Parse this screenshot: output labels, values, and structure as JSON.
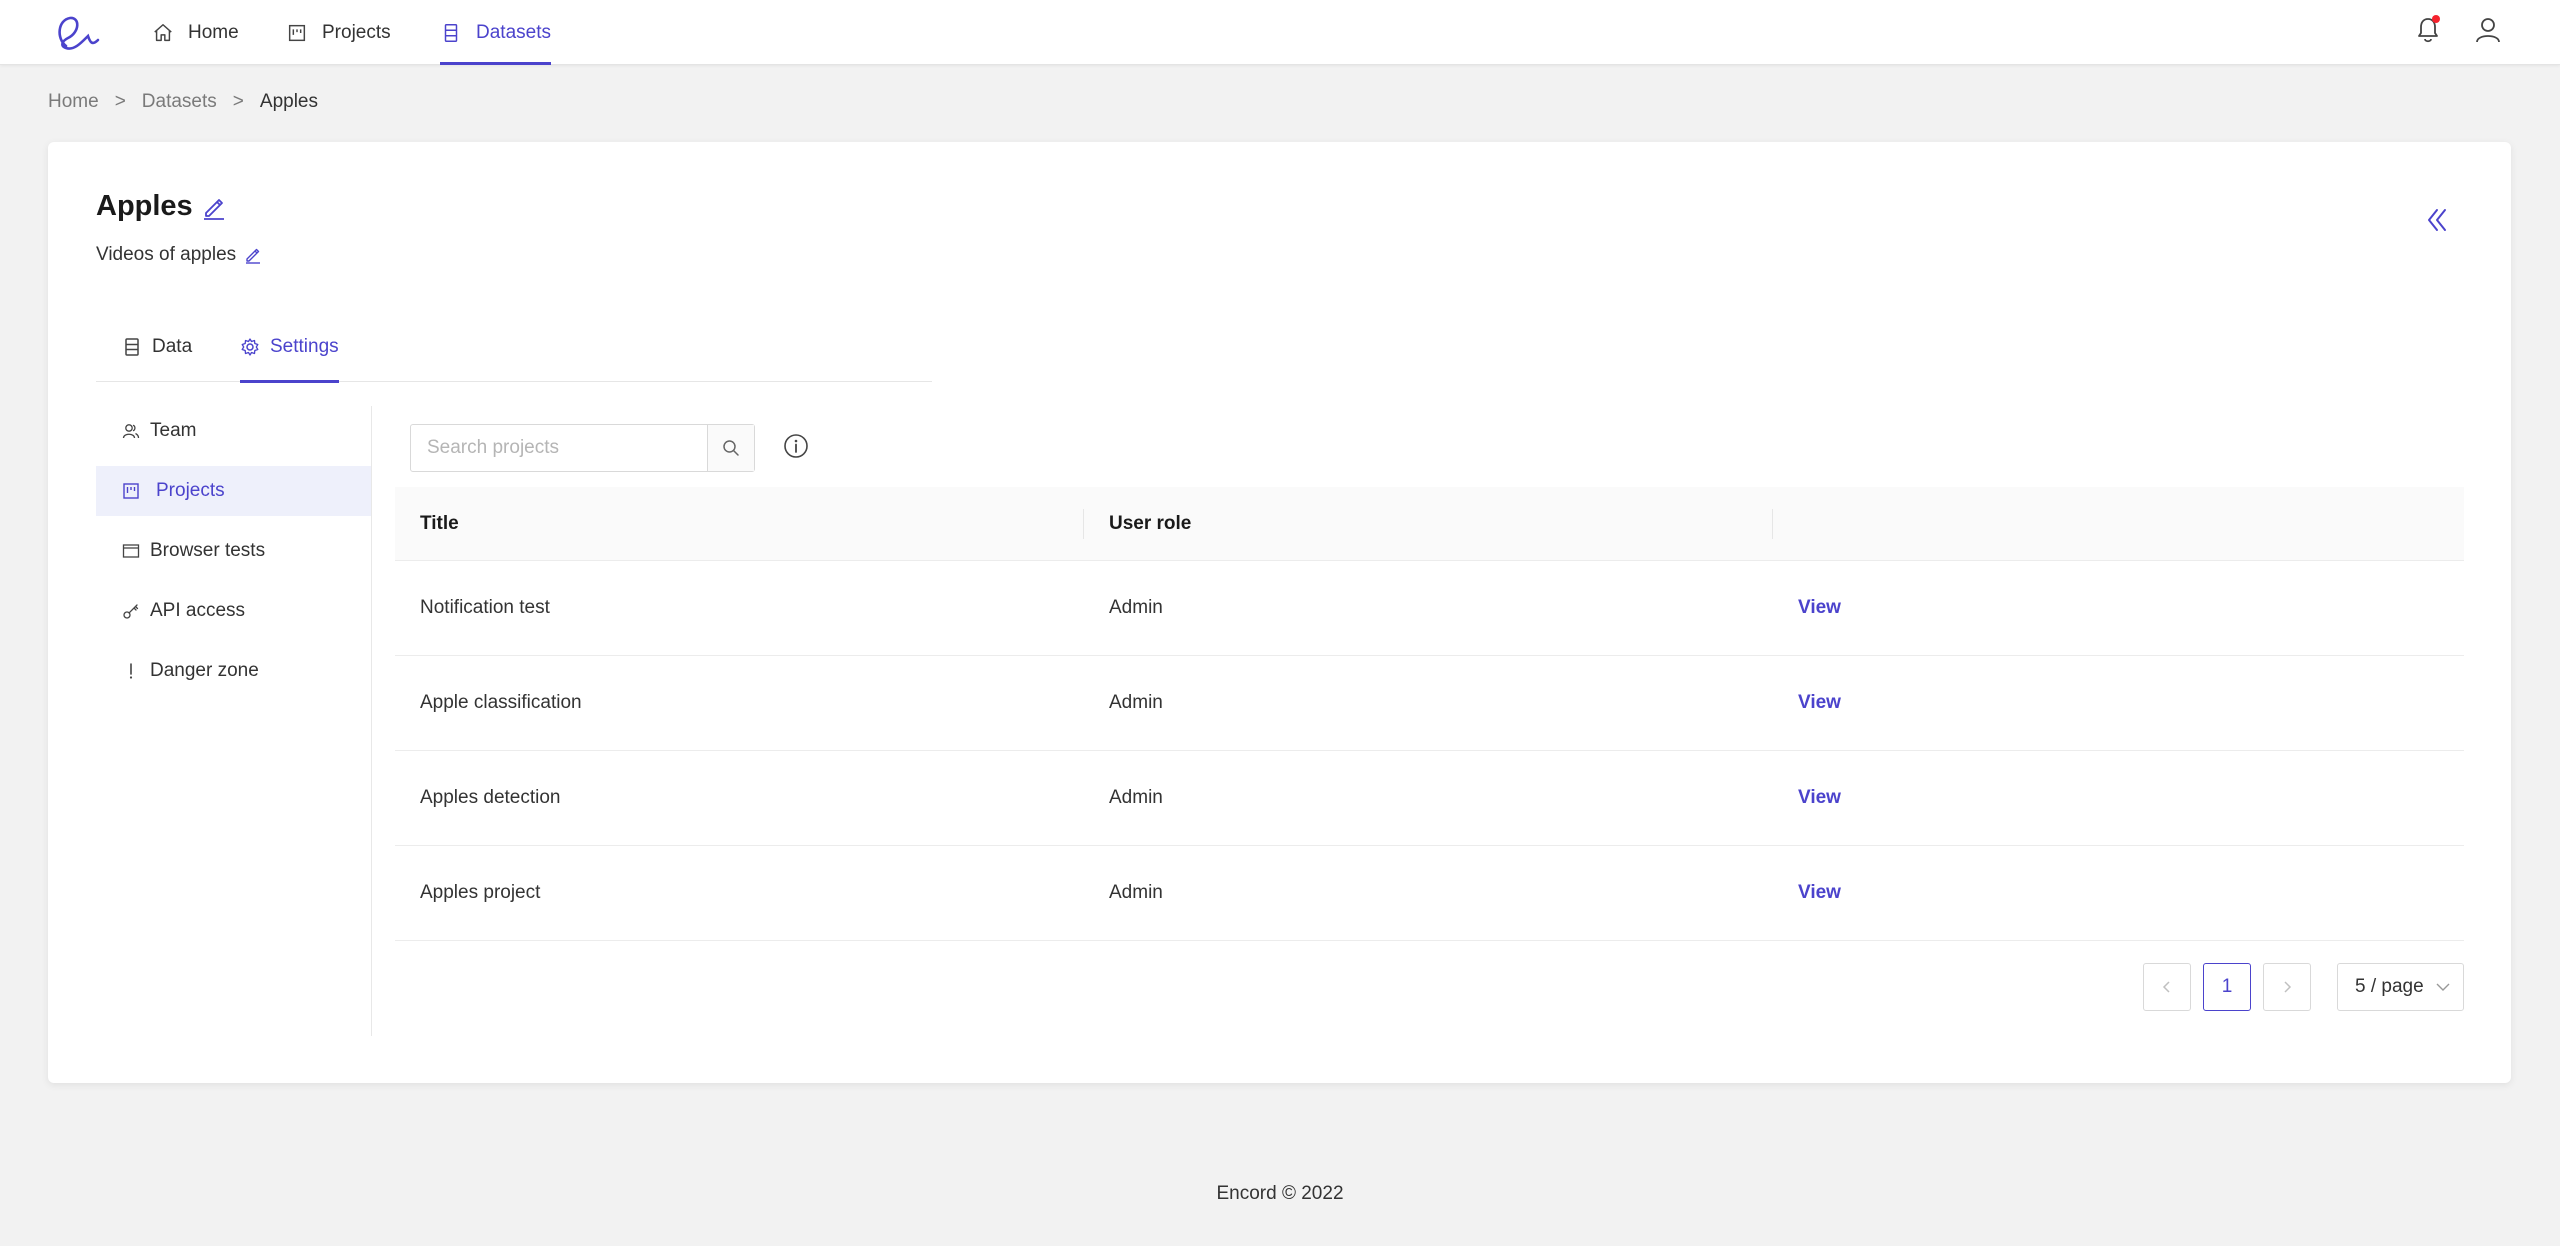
{
  "colors": {
    "accent": "#4b43cc",
    "notification_dot": "#f5222d"
  },
  "nav": {
    "items": [
      {
        "label": "Home",
        "icon": "home-icon"
      },
      {
        "label": "Projects",
        "icon": "projects-icon"
      },
      {
        "label": "Datasets",
        "icon": "datasets-icon",
        "active": true
      }
    ]
  },
  "breadcrumb": {
    "items": [
      "Home",
      "Datasets",
      "Apples"
    ],
    "separator": ">"
  },
  "dataset": {
    "title": "Apples",
    "description": "Videos of apples"
  },
  "tabs": [
    {
      "label": "Data",
      "icon": "database-icon"
    },
    {
      "label": "Settings",
      "icon": "gear-icon",
      "active": true
    }
  ],
  "settings_menu": [
    {
      "label": "Team",
      "icon": "team-icon"
    },
    {
      "label": "Projects",
      "icon": "projects-icon",
      "active": true
    },
    {
      "label": "Browser tests",
      "icon": "browser-icon"
    },
    {
      "label": "API access",
      "icon": "key-icon"
    },
    {
      "label": "Danger zone",
      "icon": "exclamation-icon"
    }
  ],
  "search": {
    "placeholder": "Search projects",
    "value": ""
  },
  "table": {
    "columns": [
      "Title",
      "User role",
      ""
    ],
    "rows": [
      {
        "title": "Notification test",
        "role": "Admin",
        "action": "View"
      },
      {
        "title": "Apple classification",
        "role": "Admin",
        "action": "View"
      },
      {
        "title": "Apples detection",
        "role": "Admin",
        "action": "View"
      },
      {
        "title": "Apples project",
        "role": "Admin",
        "action": "View"
      }
    ]
  },
  "pagination": {
    "current_page": "1",
    "page_size": "5 / page"
  },
  "footer": {
    "text": "Encord © 2022"
  }
}
